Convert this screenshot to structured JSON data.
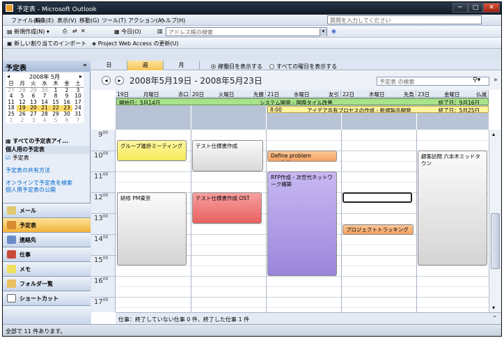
{
  "window": {
    "title": "予定表 - Microsoft Outlook",
    "min": "─",
    "max": "□",
    "close": "✕"
  },
  "menu": {
    "items": [
      "ファイル(F)",
      "編集(E)",
      "表示(V)",
      "移動(G)",
      "ツール(T)",
      "アクション(A)",
      "ヘルプ(H)"
    ],
    "help_placeholder": "質問を入力してください"
  },
  "toolbar1": {
    "new_label": "新規作成(N)",
    "today_label": "今日(O)",
    "address_placeholder": "アドレス帳の検索"
  },
  "toolbar2": {
    "import_label": "新しい割り当てのインポート",
    "pwa_label": "Project Web Access の更新(U)"
  },
  "nav": {
    "header": "予定表",
    "mini_month": "2008年 5月",
    "weekdays": [
      "日",
      "月",
      "火",
      "水",
      "木",
      "金",
      "土"
    ],
    "weeks": [
      [
        "27",
        "28",
        "29",
        "30",
        "1",
        "2",
        "3"
      ],
      [
        "4",
        "5",
        "6",
        "7",
        "8",
        "9",
        "10"
      ],
      [
        "11",
        "12",
        "13",
        "14",
        "15",
        "16",
        "17"
      ],
      [
        "18",
        "19",
        "20",
        "21",
        "22",
        "23",
        "24"
      ],
      [
        "25",
        "26",
        "27",
        "28",
        "29",
        "30",
        "31"
      ],
      [
        "1",
        "2",
        "3",
        "4",
        "5",
        "6",
        "7"
      ]
    ],
    "all_calendars": "すべての予定表アイ...",
    "personal_calendars": "個人用の予定表",
    "calendar_item": "予定表",
    "links": [
      "予定表の共有方法",
      "オンラインで予定表を検索",
      "個人用予定表の公開"
    ],
    "buttons": [
      "メール",
      "予定表",
      "連絡先",
      "仕事",
      "メモ",
      "フォルダ一覧",
      "ショートカット"
    ]
  },
  "view": {
    "tabs": [
      "日",
      "週",
      "月"
    ],
    "show_workdays": "稼働日を表示する",
    "show_all": "すべての曜日を表示する",
    "range": "2008年5月19日 - 2008年5月23日",
    "search_placeholder": "予定表 の検索"
  },
  "days": [
    {
      "num": "19日",
      "weekday": "月曜日",
      "extra": "赤口"
    },
    {
      "num": "20日",
      "weekday": "火曜日",
      "extra": "先勝"
    },
    {
      "num": "21日",
      "weekday": "水曜日",
      "extra": "友引"
    },
    {
      "num": "22日",
      "weekday": "木曜日",
      "extra": "先負"
    },
    {
      "num": "23日",
      "weekday": "金曜日",
      "extra": "仏滅"
    }
  ],
  "banners": {
    "system_start": "開始日：5月14日",
    "system_title": "システム開発 - 国際タイル改善",
    "system_end": "終了日：9月16日",
    "idea_time": "8:00",
    "idea_title": "アイデア共有プロセスの作成 - 新規製品開発",
    "idea_end": "終了日：5月25日"
  },
  "hours": [
    "9",
    "10",
    "11",
    "12",
    "13",
    "14",
    "15",
    "16",
    "17"
  ],
  "hour_suffix": "00",
  "appointments": {
    "a1": "グループ進捗ミーティング",
    "a2": "テスト仕様書作成",
    "a3": "Define problem resolution",
    "a4": "RFP作成 - 次世代ネットワーク構築",
    "a5": "研修 PM東京",
    "a6": "テスト仕様書作成 OST",
    "a7": "プロジェクトトラッキングプロセ",
    "a8": "顧客訪問 六本木ミッドタウン"
  },
  "tasks_bar": "仕事：終了していない仕事 0 件、終了した仕事 1 件",
  "status": "全部で 11 件あります。",
  "colors": {
    "system_banner": "#a8e28a",
    "idea_banner": "#fff3a0",
    "purple": "#a996e0",
    "red": "#f07a7a",
    "orange": "#f5b080",
    "yellow": "#fff27a"
  }
}
